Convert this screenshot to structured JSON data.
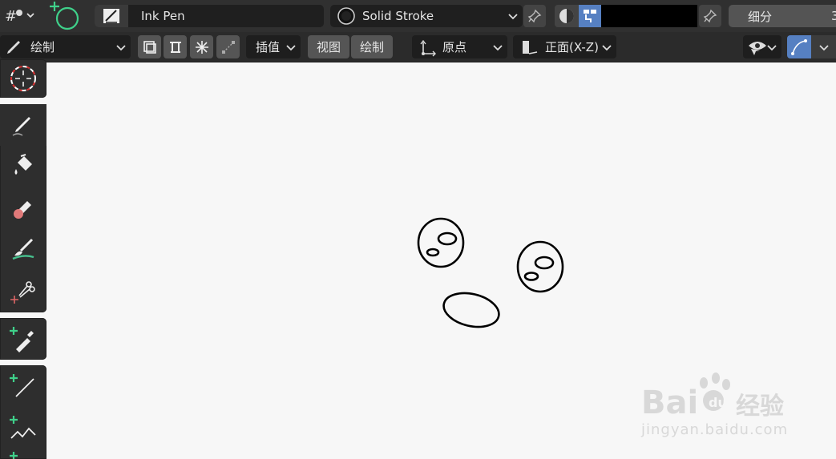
{
  "topbar": {
    "brush_name": "Ink Pen",
    "material_name": "Solid Stroke",
    "subdivide_label": "细分",
    "subdivide_value": "3"
  },
  "header": {
    "mode_label": "绘制",
    "interpolate_label": "插值",
    "view_label": "视图",
    "draw_label": "绘制",
    "origin_label": "原点",
    "orientation_label": "正面(X-Z)"
  },
  "toolbar": {
    "tools": [
      "cursor",
      "draw",
      "fill",
      "erase",
      "tint",
      "cutter",
      "eyedropper",
      "line",
      "polyline"
    ]
  },
  "watermark": {
    "brand": "Baidu",
    "brand_cn": "经验",
    "url": "jingyan.baidu.com"
  },
  "colors": {
    "accent": "#5680c2",
    "canvas": "#f7f7f7",
    "add_plus": "#3fd08a"
  }
}
